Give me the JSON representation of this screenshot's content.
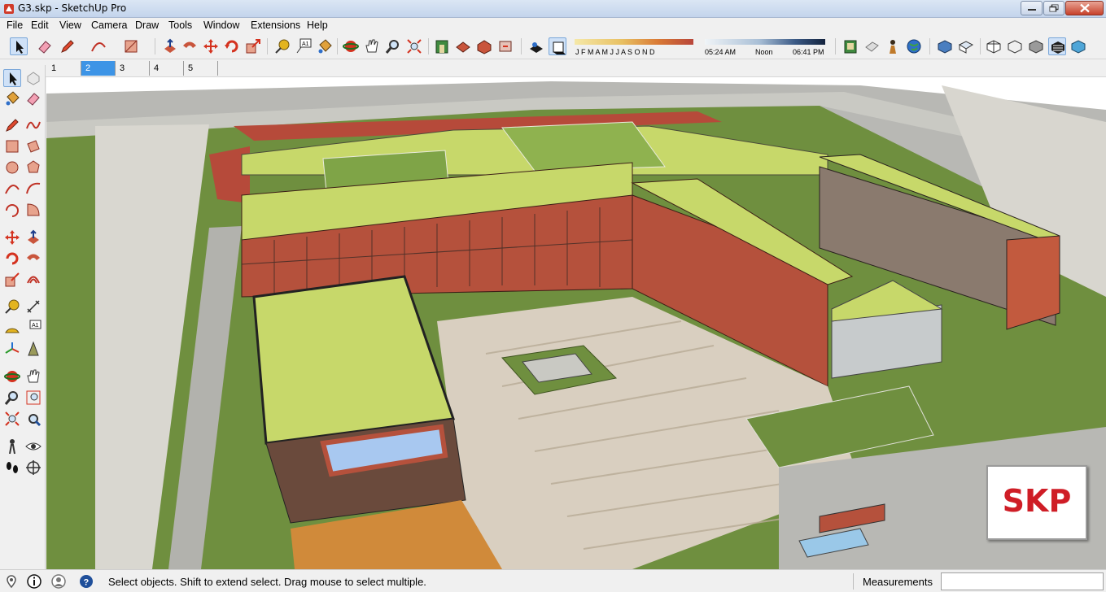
{
  "window": {
    "title": "G3.skp - SketchUp Pro",
    "controls": [
      "minimize-icon",
      "maximize-icon",
      "close-icon"
    ]
  },
  "menu": {
    "items": [
      "File",
      "Edit",
      "View",
      "Camera",
      "Draw",
      "Tools",
      "Window",
      "Extensions",
      "Help"
    ]
  },
  "toolbar": {
    "shadow_months": "J F M A M J J A S O N D",
    "time_start": "05:24 AM",
    "time_mid": "Noon",
    "time_end": "06:41 PM"
  },
  "scenes": {
    "tabs": [
      "1",
      "2",
      "3",
      "4",
      "5"
    ],
    "active": "2"
  },
  "status": {
    "message": "Select objects. Shift to extend select. Drag mouse to select multiple.",
    "measurements_label": "Measurements",
    "measurements_value": ""
  },
  "badge": {
    "text": "SKP"
  },
  "colors": {
    "accent": "#3d94e6",
    "brand_red": "#cf1d26",
    "roof_green": "#c7d86a",
    "facade_red": "#b5513c",
    "grass": "#6f8f3f",
    "plaza": "#d9cfc0",
    "running_track": "#b64a3a"
  }
}
